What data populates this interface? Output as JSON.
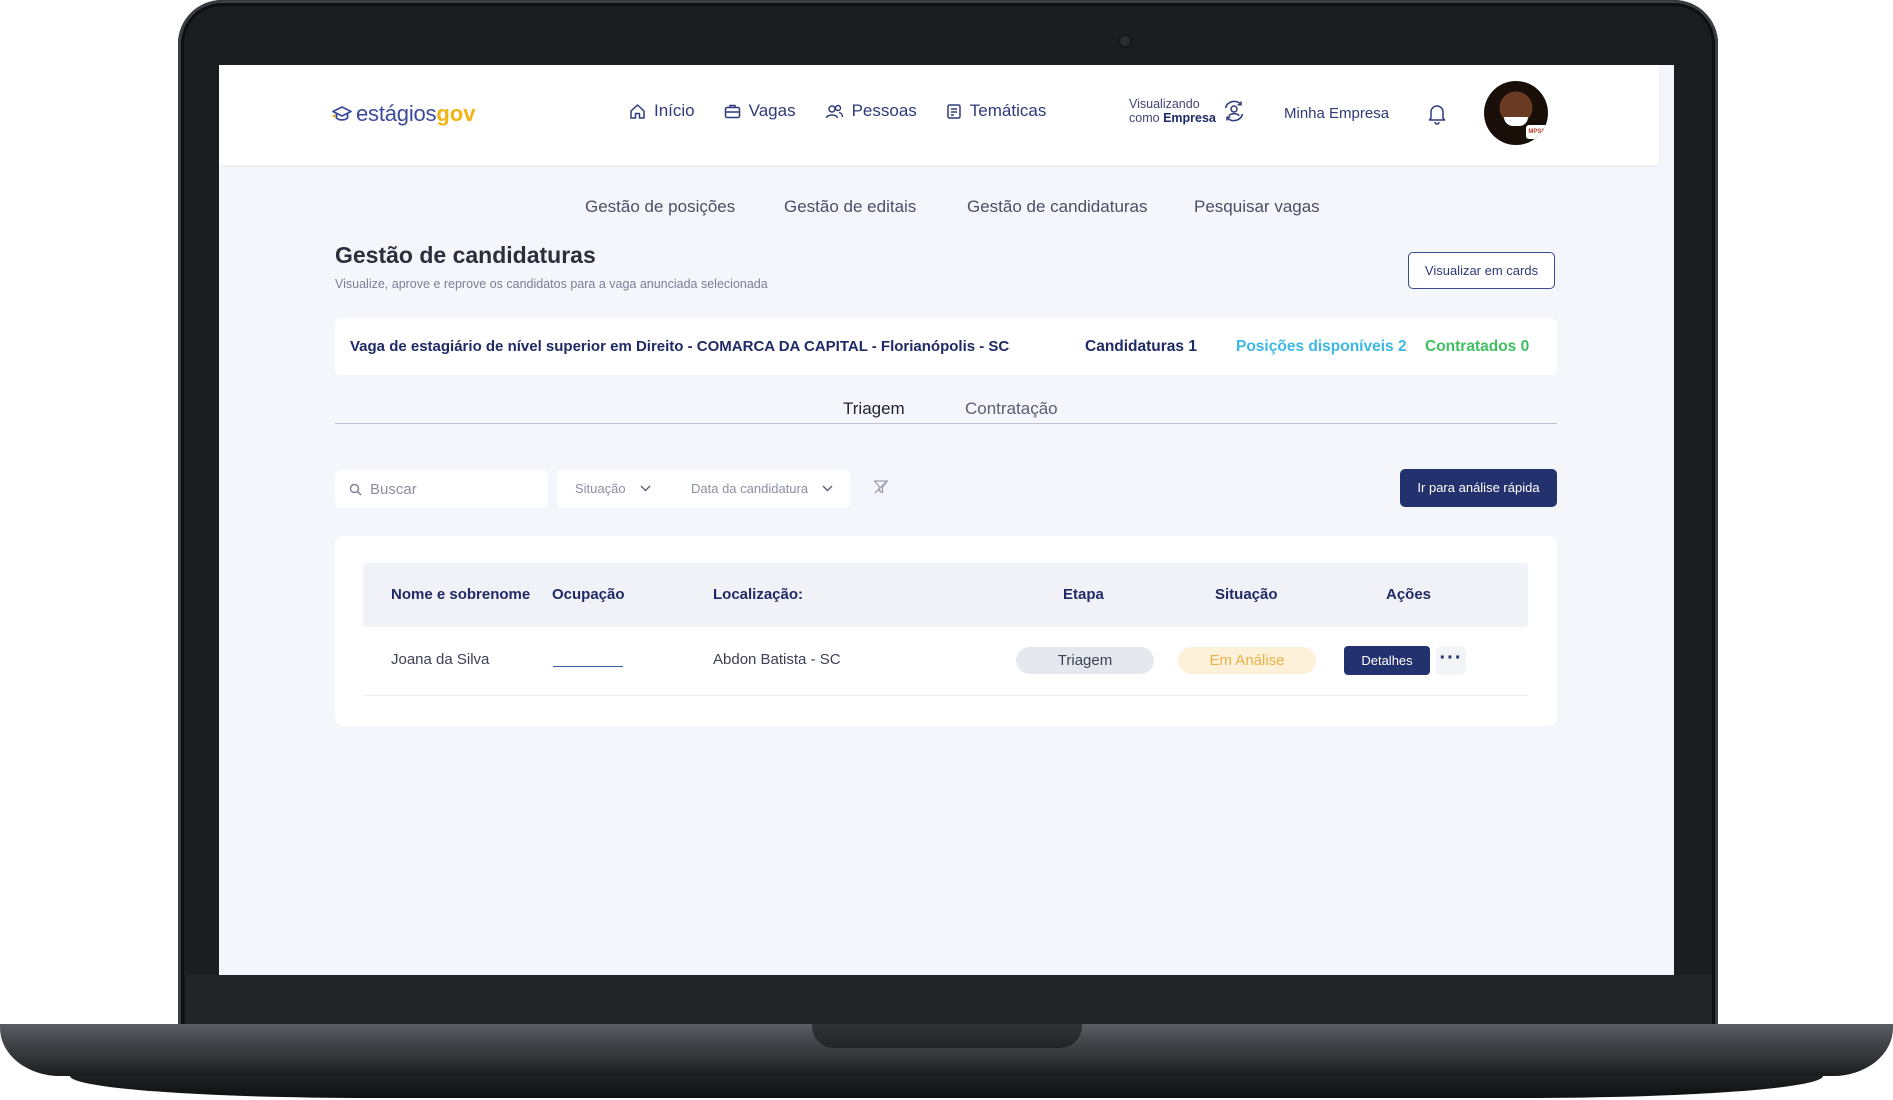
{
  "brand": {
    "part1": "estágios",
    "part2": "gov"
  },
  "nav": [
    {
      "label": "Início",
      "icon": "home-icon"
    },
    {
      "label": "Vagas",
      "icon": "briefcase-icon"
    },
    {
      "label": "Pessoas",
      "icon": "people-icon"
    },
    {
      "label": "Temáticas",
      "icon": "document-icon"
    }
  ],
  "viewing": {
    "line1": "Visualizando",
    "line2_prefix": "como",
    "line2_bold": "Empresa",
    "icon": "switch-user-icon"
  },
  "company": "Minha Empresa",
  "avatar_badge": "MPSC",
  "subnav": [
    "Gestão de posições",
    "Gestão de editais",
    "Gestão de candidaturas",
    "Pesquisar vagas"
  ],
  "page": {
    "title": "Gestão de candidaturas",
    "subtitle": "Visualize, aprove e reprove os candidatos para a vaga anunciada selecionada",
    "cards_button": "Visualizar em cards"
  },
  "vaga": {
    "title": "Vaga de estagiário de nível superior em Direito - COMARCA DA CAPITAL - Florianópolis - SC",
    "candidaturas": "Candidaturas 1",
    "posicoes": "Posições disponíveis 2",
    "contratados": "Contratados 0"
  },
  "tabs": {
    "active": "Triagem",
    "inactive": "Contratação"
  },
  "filters": {
    "search_placeholder": "Buscar",
    "situacao": "Situação",
    "data": "Data da candidatura",
    "quick_button": "Ir para análise rápida"
  },
  "table": {
    "headers": [
      "Nome e sobrenome",
      "Ocupação",
      "Localização:",
      "Etapa",
      "Situação",
      "Ações"
    ],
    "rows": [
      {
        "nome": "Joana da Silva",
        "ocupacao": "",
        "localizacao": "Abdon Batista - SC",
        "etapa": "Triagem",
        "situacao": "Em Análise",
        "acao": "Detalhes",
        "more": "···"
      }
    ]
  },
  "colors": {
    "primary": "#23316e",
    "accent_yellow": "#f2b415",
    "posicoes": "#3bb8e8",
    "contratados": "#3fbf5f",
    "etapa_bg": "#e6e8f0",
    "situacao_bg": "#fdf1d9",
    "situacao_fg": "#e8b04a"
  }
}
